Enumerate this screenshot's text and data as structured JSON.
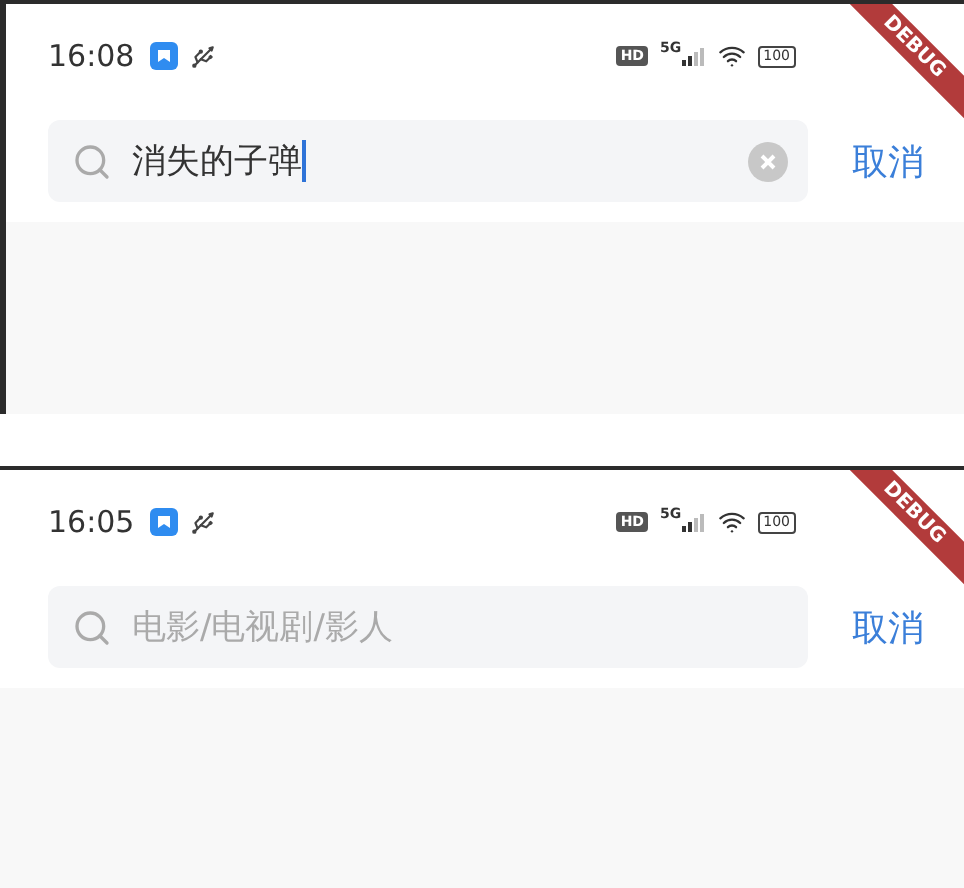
{
  "screens": [
    {
      "status_bar": {
        "time": "16:08",
        "hd": "HD",
        "network": "5G",
        "battery": "100"
      },
      "search": {
        "value": "消失的子弹",
        "focused": true
      },
      "cancel": "取消",
      "debug_banner": "DEBUG"
    },
    {
      "status_bar": {
        "time": "16:05",
        "hd": "HD",
        "network": "5G",
        "battery": "100"
      },
      "search": {
        "placeholder": "电影/电视剧/影人",
        "focused": false
      },
      "cancel": "取消",
      "debug_banner": "DEBUG"
    }
  ]
}
